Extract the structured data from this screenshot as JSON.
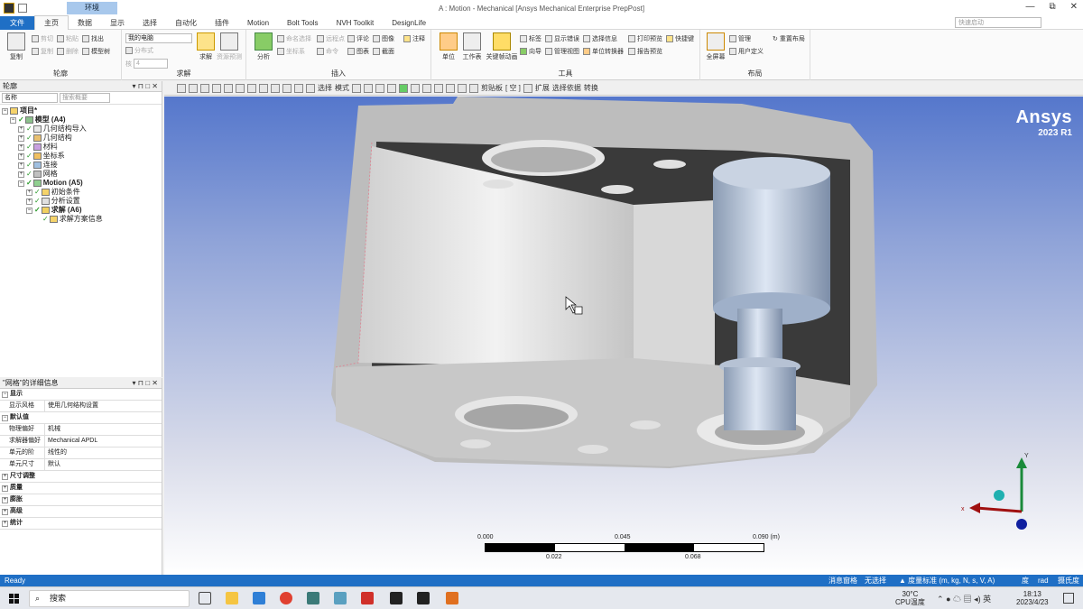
{
  "window": {
    "title": "A : Motion - Mechanical [Ansys Mechanical Enterprise PrepPost]",
    "context_tab": "环境",
    "controls": [
      "—",
      "⧉",
      "✕"
    ]
  },
  "tabs": [
    {
      "label": "文件"
    },
    {
      "label": "主页"
    },
    {
      "label": "数据"
    },
    {
      "label": "显示"
    },
    {
      "label": "选择"
    },
    {
      "label": "自动化"
    },
    {
      "label": "插件"
    },
    {
      "label": "Motion"
    },
    {
      "label": "Bolt Tools"
    },
    {
      "label": "NVH Toolkit"
    },
    {
      "label": "DesignLife"
    }
  ],
  "quick_search": {
    "placeholder": "快速启动"
  },
  "ribbon": {
    "outline_group": {
      "label": "轮廓",
      "copy": "复制",
      "cut": "剪切",
      "paste": "粘贴",
      "find": "找出",
      "duplicate": "复制",
      "delete": "删除",
      "tree": "模型树"
    },
    "solve_group": {
      "label": "求解",
      "my_computer": "我的电脑",
      "distributed": "分布式",
      "cores_label": "核",
      "cores_value": "4",
      "solve": "求解",
      "resource": "资源预测"
    },
    "insert_group": {
      "label": "插入",
      "analysis": "分析",
      "named_sel": "命名选择",
      "coord": "坐标系",
      "remote_pt": "远程点",
      "command": "命令",
      "comment": "评论",
      "chart": "图表",
      "images": "图像",
      "section": "截面",
      "annotation": "注释"
    },
    "tools_group": {
      "label": "工具",
      "units": "单位",
      "worksheet": "工作表",
      "keyframe": "关键帧动画",
      "tag": "标签",
      "show_errors": "显示错误",
      "select_info": "选择信息",
      "print_preview": "打印预览",
      "shortcuts": "快捷键",
      "wizard": "向导",
      "manage_views": "管理视图",
      "unit_converter": "单位转换器",
      "report_preview": "报告预览"
    },
    "layout_group": {
      "label": "布局",
      "fullscreen": "全屏幕",
      "manage": "管理",
      "user_defined": "用户定义",
      "reset_layout": "重置布局"
    }
  },
  "viewport_toolbar": {
    "select": "选择",
    "mode": "模式",
    "clipboard": "剪贴板",
    "empty": "[ 空 ]",
    "extend": "扩展",
    "select_by": "选择依据",
    "convert": "转换"
  },
  "outline": {
    "title": "轮廓",
    "controls": "▾ ⊓ □ ✕",
    "filter_select": "名称",
    "search_placeholder": "搜索概要",
    "tree": [
      {
        "label": "项目*",
        "level": 0,
        "bold": true
      },
      {
        "label": "模型 (A4)",
        "level": 1,
        "bold": true
      },
      {
        "label": "几何结构导入",
        "level": 2,
        "bold": false
      },
      {
        "label": "几何结构",
        "level": 2,
        "bold": false
      },
      {
        "label": "材料",
        "level": 2,
        "bold": false
      },
      {
        "label": "坐标系",
        "level": 2,
        "bold": false
      },
      {
        "label": "连接",
        "level": 2,
        "bold": false
      },
      {
        "label": "网格",
        "level": 2,
        "bold": false
      },
      {
        "label": "Motion (A5)",
        "level": 2,
        "bold": true
      },
      {
        "label": "初始条件",
        "level": 3,
        "bold": false
      },
      {
        "label": "分析设置",
        "level": 3,
        "bold": false
      },
      {
        "label": "求解 (A6)",
        "level": 3,
        "bold": true
      },
      {
        "label": "求解方案信息",
        "level": 4,
        "bold": false
      }
    ]
  },
  "details": {
    "title": "\"网格\"的详细信息",
    "controls": "▾ ⊓ □ ✕",
    "sections": [
      {
        "name": "显示",
        "rows": [
          {
            "k": "显示风格",
            "v": "使用几何结构设置"
          }
        ]
      },
      {
        "name": "默认值",
        "rows": [
          {
            "k": "物理偏好",
            "v": "机械"
          },
          {
            "k": "求解器偏好",
            "v": "Mechanical APDL"
          },
          {
            "k": "单元的阶",
            "v": "线性的"
          },
          {
            "k": "单元尺寸",
            "v": "默认"
          }
        ]
      },
      {
        "name": "尺寸调整",
        "rows": []
      },
      {
        "name": "质量",
        "rows": []
      },
      {
        "name": "膨胀",
        "rows": []
      },
      {
        "name": "高级",
        "rows": []
      },
      {
        "name": "统计",
        "rows": []
      }
    ]
  },
  "viewport": {
    "logo_name": "Ansys",
    "logo_version": "2023 R1",
    "axis_x": "x",
    "axis_y": "Y",
    "scale": {
      "top_labels": [
        "0.000",
        "0.045",
        "0.090 (m)"
      ],
      "bottom_labels": [
        "0.022",
        "0.068"
      ]
    }
  },
  "status": {
    "ready": "Ready",
    "messages": "消息窗格",
    "no_selection": "无选择",
    "units": "▲ 度量标准 (m, kg, N, s, V, A)",
    "deg": "度",
    "rad": "rad",
    "temp_units": "摄氏度"
  },
  "taskbar": {
    "search": "搜索",
    "weather_temp": "30°C",
    "weather_label": "CPU温度",
    "time": "18:13",
    "date": "2023/4/23",
    "lang": "英"
  }
}
